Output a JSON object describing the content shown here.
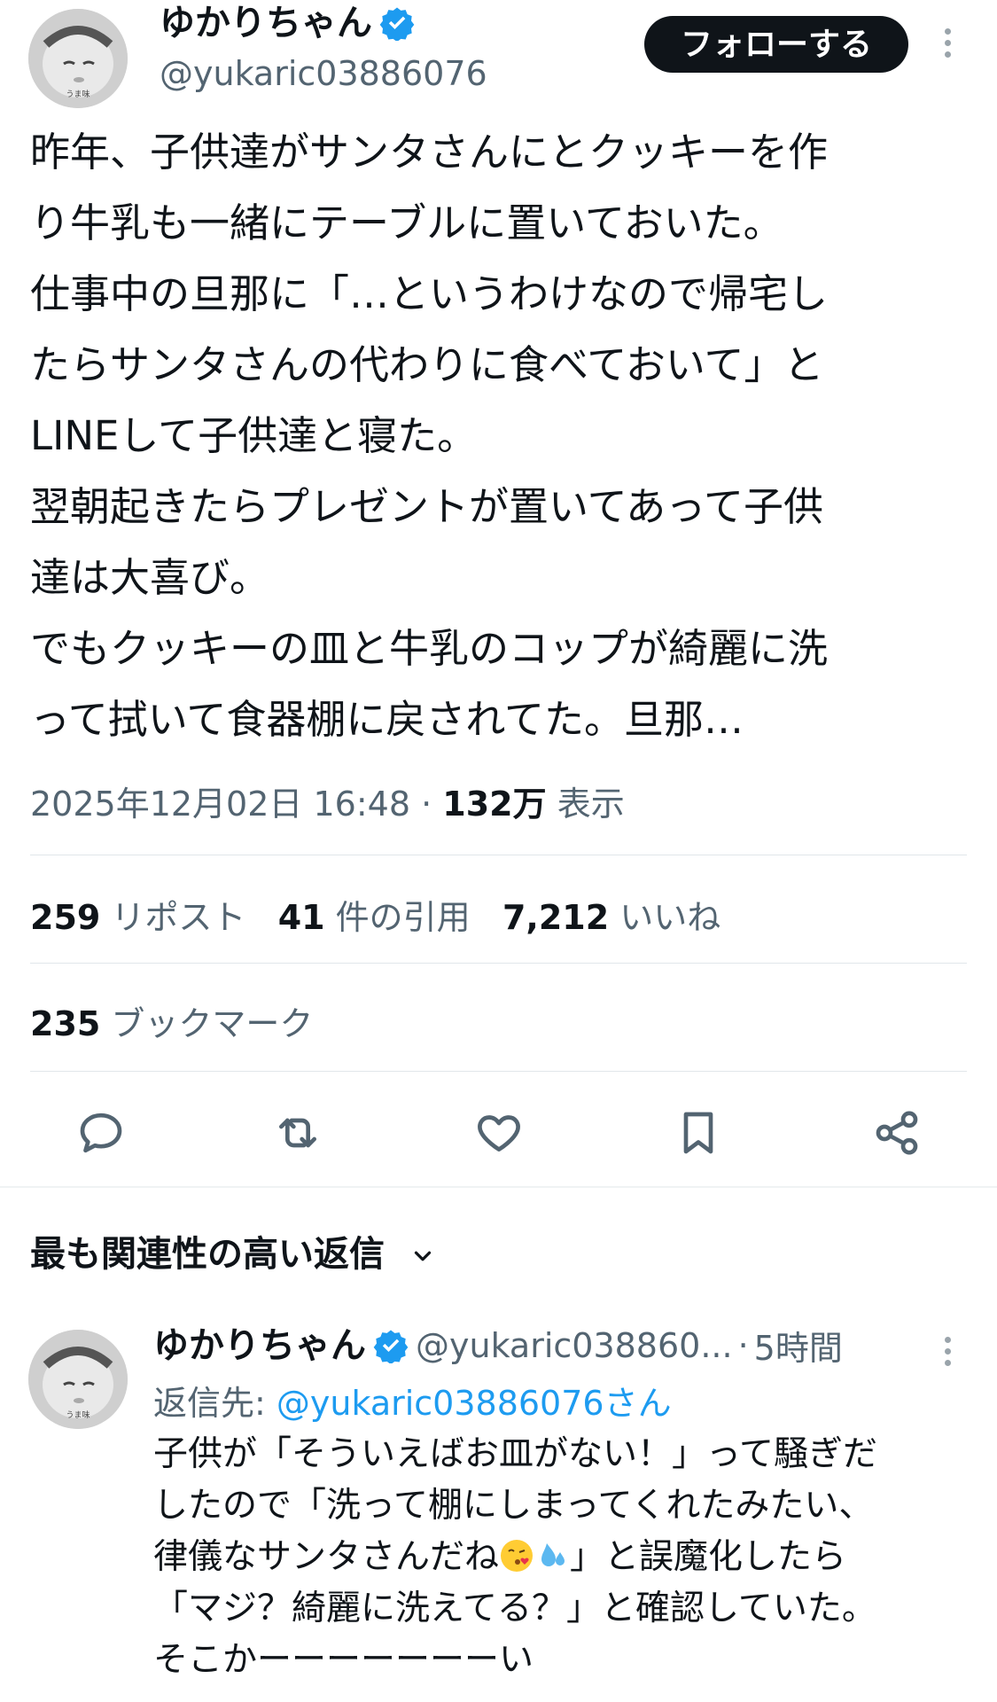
{
  "author": {
    "display_name": "ゆかりちゃん",
    "handle": "@yukaric03886076",
    "avatar_caption": "うま味",
    "verified_icon": "verified-badge-icon"
  },
  "header": {
    "follow_label": "フォローする"
  },
  "tweet": {
    "lines": [
      "昨年、子供達がサンタさんにとクッキーを作",
      "り牛乳も一緒にテーブルに置いておいた。",
      "仕事中の旦那に「…というわけなので帰宅し",
      "たらサンタさんの代わりに食べておいて」と",
      "LINEして子供達と寝た。",
      "翌朝起きたらプレゼントが置いてあって子供",
      "達は大喜び。",
      "でもクッキーの皿と牛乳のコップが綺麗に洗",
      "って拭いて食器棚に戻されてた。旦那…"
    ],
    "timestamp": "2025年12月02日 16:48",
    "dot": "·",
    "views_count": "132万",
    "views_label": "表示"
  },
  "stats": {
    "reposts_count": "259",
    "reposts_label": "リポスト",
    "quotes_count": "41",
    "quotes_label": "件の引用",
    "likes_count": "7,212",
    "likes_label": "いいね",
    "bookmarks_count": "235",
    "bookmarks_label": "ブックマーク"
  },
  "actions": {
    "reply_icon": "reply-icon",
    "repost_icon": "repost-icon",
    "like_icon": "heart-icon",
    "bookmark_icon": "bookmark-icon",
    "share_icon": "share-icon"
  },
  "replies_section": {
    "sort_label": "最も関連性の高い返信"
  },
  "reply": {
    "display_name": "ゆかりちゃん",
    "handle": "@yukaric038860...",
    "dot": "·",
    "time": "5時間",
    "reply_to_label": "返信先:",
    "reply_to_handle": "@yukaric03886076さん",
    "lines": [
      "子供が「そういえばお皿がない！」って騒ぎだ",
      "したので「洗って棚にしまってくれたみたい、",
      "律儀なサンタさんだね",
      "」と誤魔化したら",
      "「マジ？綺麗に洗えてる？」と確認していた。",
      "そこかーーーーーーーい"
    ],
    "emojis": [
      "kissing-face-emoji",
      "sweat-droplets-emoji"
    ]
  },
  "colors": {
    "text": "#0f1419",
    "secondary": "#536471",
    "accent": "#1d9bf0",
    "follow_bg": "#0f1419"
  }
}
